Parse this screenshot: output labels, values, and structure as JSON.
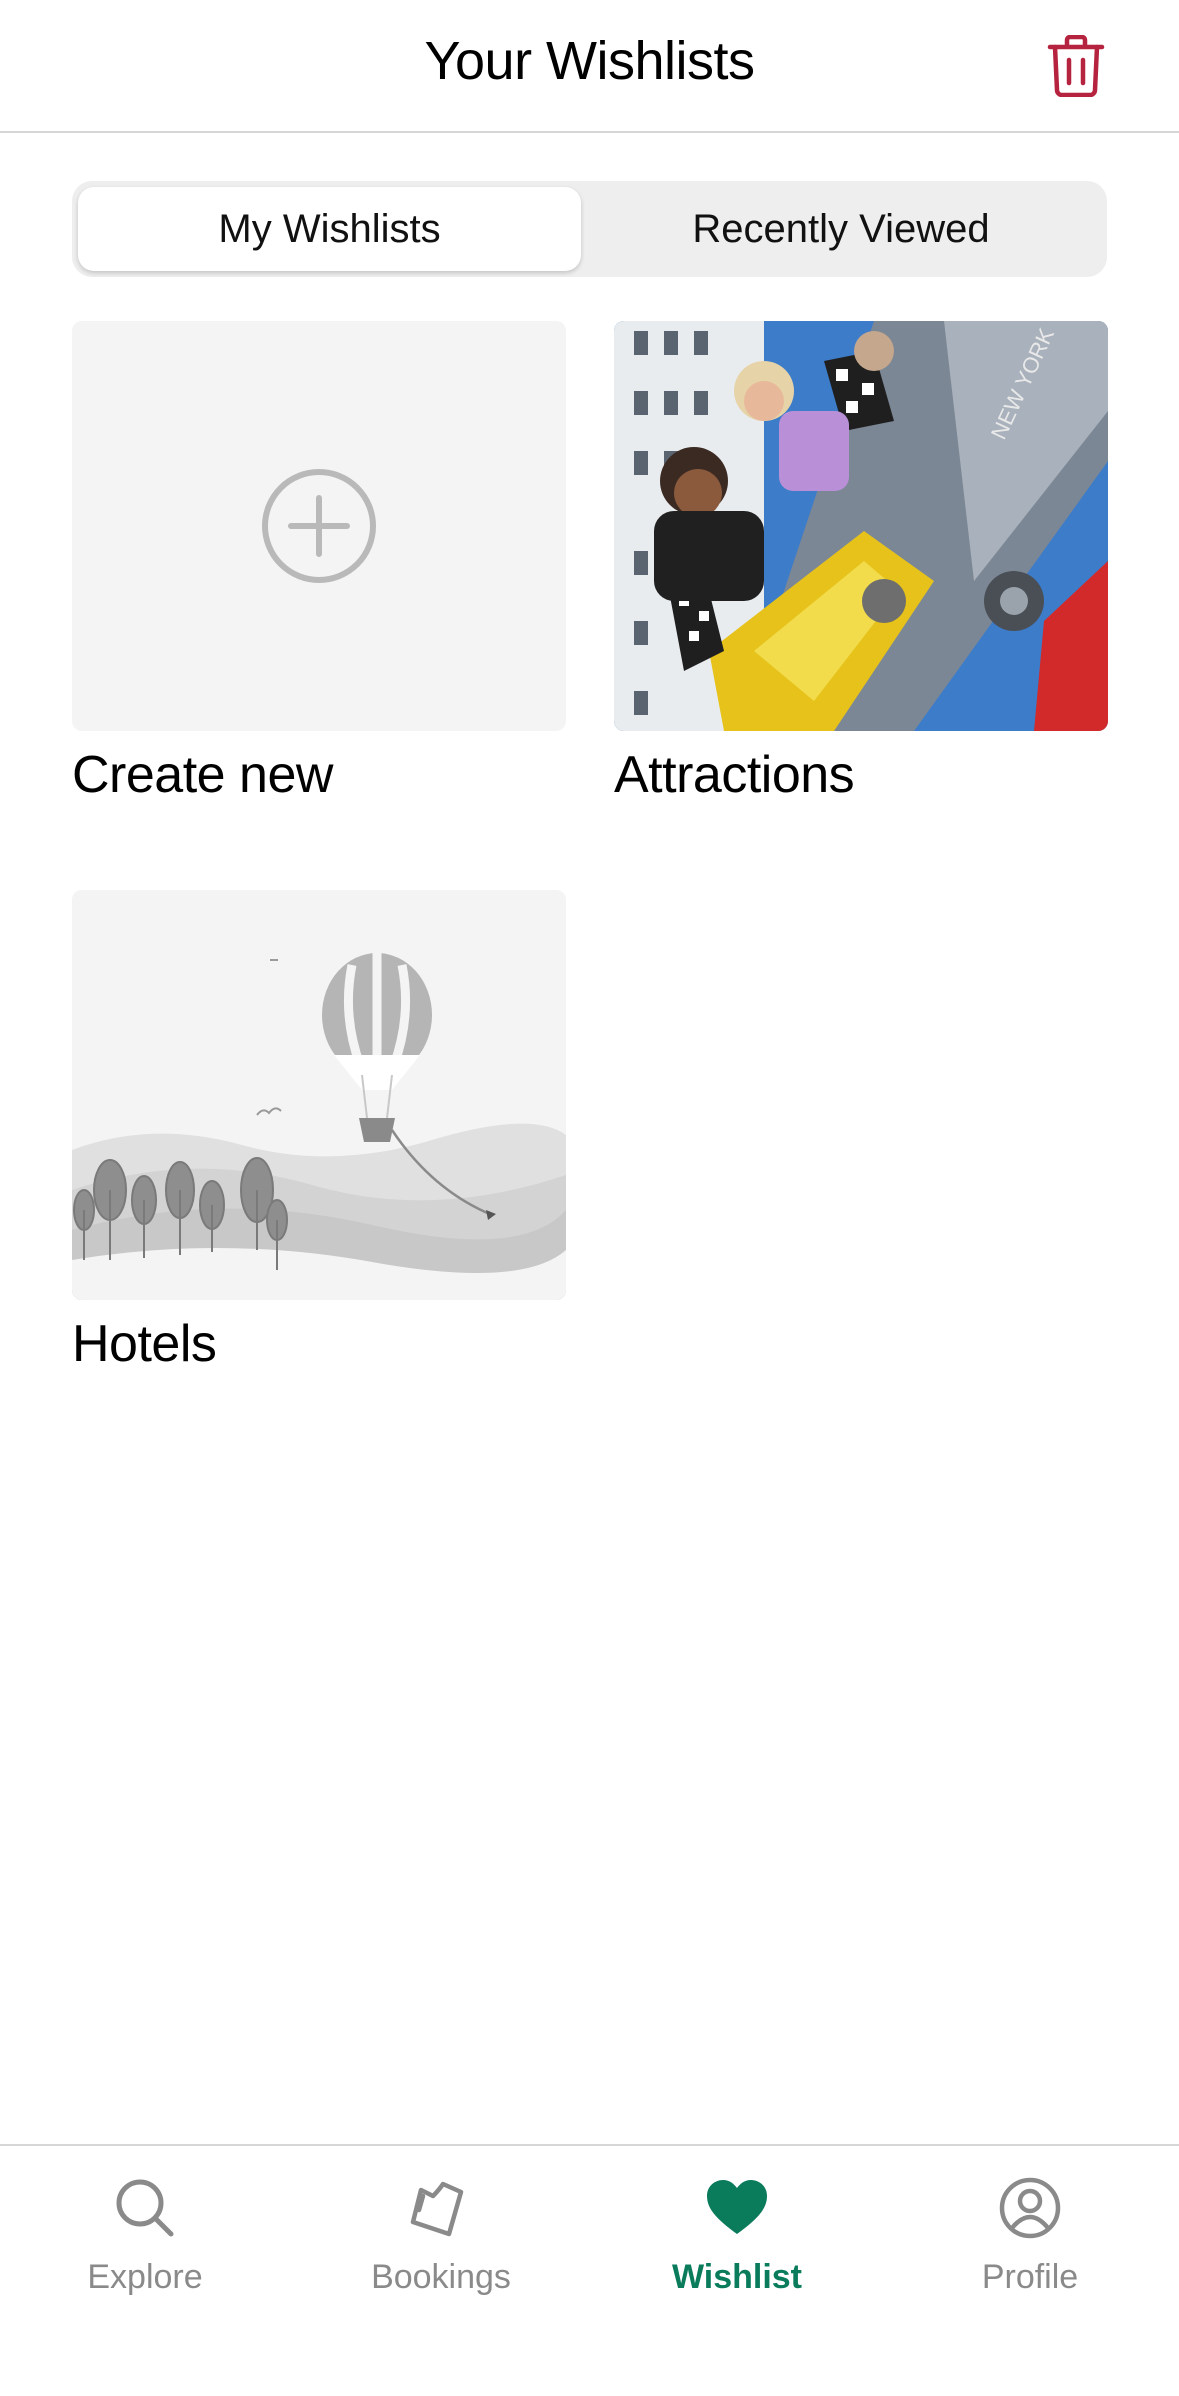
{
  "header": {
    "title": "Your Wishlists",
    "trash_icon": "trash-icon"
  },
  "tabs": [
    {
      "label": "My Wishlists",
      "selected": true
    },
    {
      "label": "Recently Viewed",
      "selected": false
    }
  ],
  "wishlists": [
    {
      "label": "Create new",
      "icon": "plus-circle-icon"
    },
    {
      "label": "Attractions",
      "image": "roller-coaster-photo"
    },
    {
      "label": "Hotels",
      "image": "hot-air-balloon-illustration"
    }
  ],
  "bottom_nav": [
    {
      "label": "Explore",
      "icon": "search-icon",
      "active": false
    },
    {
      "label": "Bookings",
      "icon": "ticket-icon",
      "active": false
    },
    {
      "label": "Wishlist",
      "icon": "heart-icon",
      "active": true
    },
    {
      "label": "Profile",
      "icon": "user-circle-icon",
      "active": false
    }
  ],
  "colors": {
    "accent": "#0a7c5c",
    "trash": "#b5233f",
    "inactive": "#8a8a8a"
  }
}
